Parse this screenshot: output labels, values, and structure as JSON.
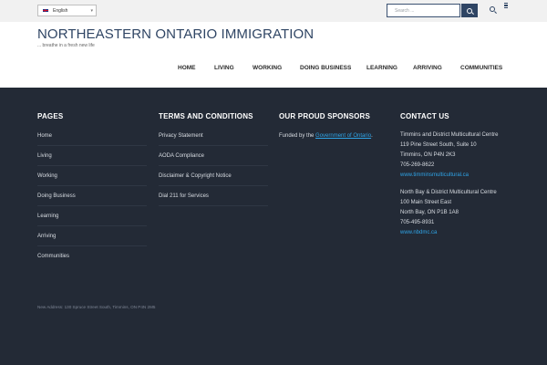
{
  "topbar": {
    "language": "English",
    "search_placeholder": "Search ..."
  },
  "header": {
    "site_title": "NORTHEASTERN ONTARIO IMMIGRATION",
    "tagline": "... breathe in a fresh new life"
  },
  "nav": {
    "items": [
      "HOME",
      "LIVING",
      "WORKING",
      "DOING BUSINESS",
      "LEARNING",
      "ARRIVING",
      "COMMUNITIES"
    ]
  },
  "footer": {
    "pages": {
      "title": "PAGES",
      "items": [
        "Home",
        "Living",
        "Working",
        "Doing Business",
        "Learning",
        "Arriving",
        "Communities"
      ]
    },
    "terms": {
      "title": "TERMS AND CONDITIONS",
      "items": [
        "Privacy Statement",
        "AODA Compliance",
        "Disclaimer & Copyright Notice",
        "Dial 211 for Services"
      ]
    },
    "sponsors": {
      "title": "OUR PROUD SPONSORS",
      "prefix": "Funded by the ",
      "link": "Government of Ontario",
      "suffix": "."
    },
    "contact": {
      "title": "CONTACT US",
      "office1": {
        "name": "Timmins and District Multicultural Centre",
        "street": "119 Pine Street South, Suite 10",
        "city": "Timmins, ON P4N 2K3",
        "phone": "705-269-8622",
        "web": "www.timminsmulticultural.ca"
      },
      "office2": {
        "name": "North Bay & District Multicultural Centre",
        "street": "100 Main Street East",
        "city": "North Bay, ON P1B 1A8",
        "phone": "705-495-8931",
        "web": "www.nbdmc.ca"
      }
    },
    "address": "New Address: 130 Spruce Street South, Timmins, ON P4N 2M5"
  },
  "colors": {
    "brand": "#2f4564",
    "footer_bg": "#232a36",
    "link": "#2fa4e7"
  }
}
